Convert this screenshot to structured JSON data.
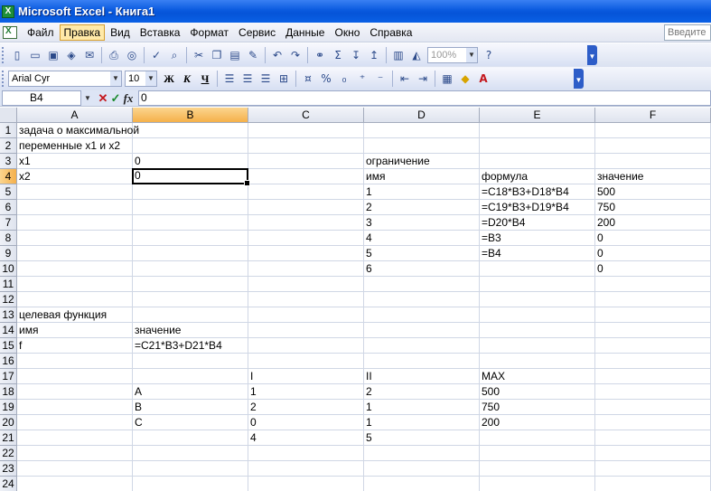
{
  "window": {
    "title": "Microsoft Excel - Книга1"
  },
  "menu": {
    "items": [
      "Файл",
      "Правка",
      "Вид",
      "Вставка",
      "Формат",
      "Сервис",
      "Данные",
      "Окно",
      "Справка"
    ],
    "active_index": 1,
    "help_placeholder": "Введите"
  },
  "toolbar": {
    "zoom": "100%",
    "font_name": "Arial Cyr",
    "font_size": "10",
    "bold": "Ж",
    "italic": "К",
    "underline": "Ч"
  },
  "formula_bar": {
    "name_box": "B4",
    "cancel": "✕",
    "enter": "✓",
    "fx": "fx",
    "content": "0"
  },
  "sheet": {
    "columns": [
      "A",
      "B",
      "C",
      "D",
      "E",
      "F"
    ],
    "selected_column": "B",
    "rows": [
      "1",
      "2",
      "3",
      "4",
      "5",
      "6",
      "7",
      "8",
      "9",
      "10",
      "11",
      "12",
      "13",
      "14",
      "15",
      "16",
      "17",
      "18",
      "19",
      "20",
      "21",
      "22",
      "23",
      "24"
    ],
    "selected_row": "4",
    "active_cell": "B4",
    "cells": {
      "A1": "задача о максимальной",
      "A2": "переменные x1 и x2",
      "A3": "x1",
      "B3": "0",
      "D3": "ограничение",
      "A4": "x2",
      "B4": "0",
      "D4": "имя",
      "E4": "формула",
      "F4": "значение",
      "D5": "1",
      "E5": "=C18*B3+D18*B4",
      "F5": "500",
      "D6": "2",
      "E6": "=C19*B3+D19*B4",
      "F6": "750",
      "D7": "3",
      "E7": "=D20*B4",
      "F7": "200",
      "D8": "4",
      "E8": "=B3",
      "F8": "0",
      "D9": "5",
      "E9": "=B4",
      "F9": "0",
      "D10": "6",
      "F10": "0",
      "A13": "целевая функция",
      "A14": "имя",
      "B14": "значение",
      "A15": "f",
      "B15": "=C21*B3+D21*B4",
      "C17": "I",
      "D17": "II",
      "E17": "MAX",
      "B18": "A",
      "C18": "1",
      "D18": "2",
      "E18": "500",
      "B19": "B",
      "C19": "2",
      "D19": "1",
      "E19": "750",
      "B20": "C",
      "C20": "0",
      "D20": "1",
      "E20": "200",
      "C21": "4",
      "D21": "5"
    }
  }
}
